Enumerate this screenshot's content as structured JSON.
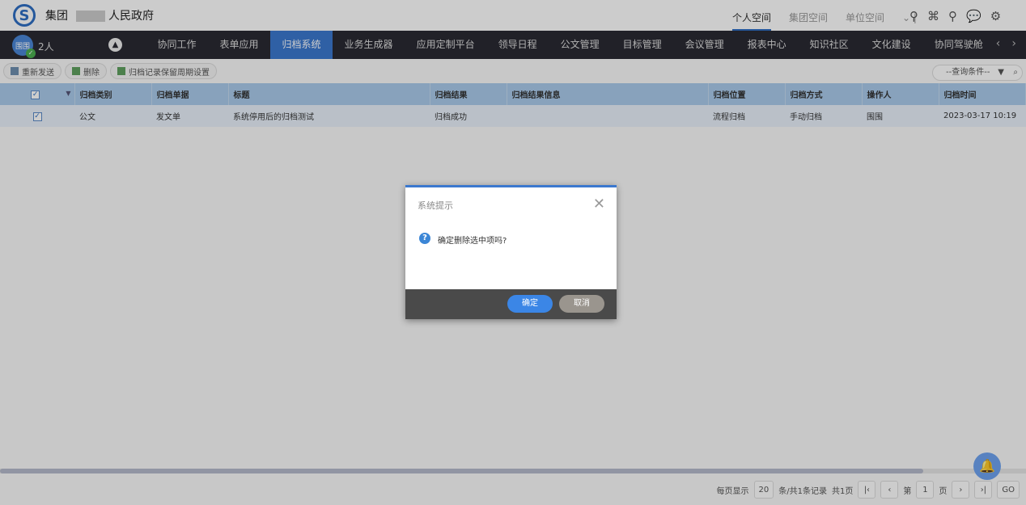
{
  "header": {
    "group": "集团",
    "org": "人民政府",
    "spaces": [
      "个人空间",
      "集团空间",
      "单位空间"
    ]
  },
  "nav": {
    "avatar_text": "围围",
    "online_count": "2人",
    "tabs": [
      "协同工作",
      "表单应用",
      "归档系统",
      "业务生成器",
      "应用定制平台",
      "领导日程",
      "公文管理",
      "目标管理",
      "会议管理",
      "报表中心",
      "知识社区",
      "文化建设",
      "协同驾驶舱"
    ],
    "active_tab": "归档系统"
  },
  "toolbar": {
    "resend": "重新发送",
    "delete": "删除",
    "retention": "归档记录保留周期设置",
    "query_placeholder": "--查询条件--"
  },
  "table": {
    "headers": [
      "归档类别",
      "归档单据",
      "标题",
      "归档结果",
      "归档结果信息",
      "归档位置",
      "归档方式",
      "操作人",
      "归档时间"
    ],
    "rows": [
      [
        "公文",
        "发文单",
        "系统停用后的归档测试",
        "归档成功",
        "",
        "流程归档",
        "手动归档",
        "围围",
        "2023-03-17 10:19"
      ]
    ]
  },
  "pager": {
    "per_page_label": "每页显示",
    "per_page": "20",
    "records": "条/共1条记录",
    "total_pages": "共1页",
    "page_prefix": "第",
    "page": "1",
    "page_suffix": "页",
    "go": "GO"
  },
  "dialog": {
    "title": "系统提示",
    "message": "确定删除选中项吗?",
    "ok": "确定",
    "cancel": "取消"
  },
  "colors": {
    "accent": "#3b78cf",
    "nav_bg": "#2a2a33"
  }
}
